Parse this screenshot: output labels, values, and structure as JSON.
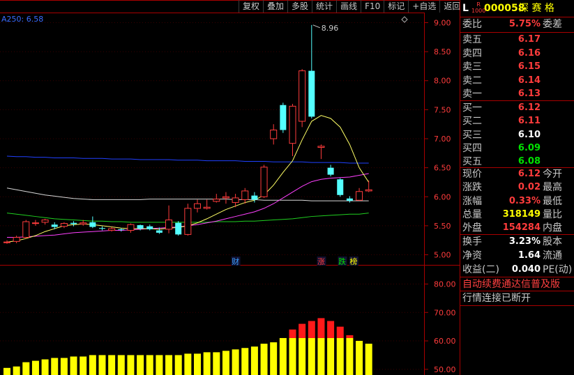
{
  "toolbar": {
    "items": [
      "复权",
      "叠加",
      "多股",
      "统计",
      "画线",
      "F10",
      "标记",
      "+自选",
      "返回"
    ]
  },
  "indicator_label": "A250: 6.58",
  "high_label": "8.96",
  "event_marks": [
    {
      "text": "财",
      "color": "#3aa0ff"
    },
    {
      "text": "涨",
      "color": "#ff3c3c"
    },
    {
      "text": "跌",
      "color": "#00e000"
    },
    {
      "text": "榜",
      "color": "#ffff00"
    }
  ],
  "header": {
    "prefix": "L",
    "badge": "R\n1000",
    "code": "000058",
    "name": "深 赛 格"
  },
  "quote": {
    "weibi": {
      "label": "委比",
      "value": "5.75%",
      "label2": "委差"
    },
    "sells": [
      {
        "label": "卖五",
        "value": "6.17"
      },
      {
        "label": "卖四",
        "value": "6.16"
      },
      {
        "label": "卖三",
        "value": "6.15"
      },
      {
        "label": "卖二",
        "value": "6.14"
      },
      {
        "label": "卖一",
        "value": "6.13"
      }
    ],
    "buys": [
      {
        "label": "买一",
        "value": "6.12",
        "color": "red"
      },
      {
        "label": "买二",
        "value": "6.11",
        "color": "red"
      },
      {
        "label": "买三",
        "value": "6.10",
        "color": "white"
      },
      {
        "label": "买四",
        "value": "6.09",
        "color": "green"
      },
      {
        "label": "买五",
        "value": "6.08",
        "color": "green"
      }
    ],
    "stats": [
      {
        "label": "现价",
        "value": "6.12",
        "color": "red",
        "label2": "今开"
      },
      {
        "label": "涨跌",
        "value": "0.02",
        "color": "red",
        "label2": "最高"
      },
      {
        "label": "涨幅",
        "value": "0.33%",
        "color": "red",
        "label2": "最低"
      },
      {
        "label": "总量",
        "value": "318149",
        "color": "yellow",
        "label2": "量比"
      },
      {
        "label": "外盘",
        "value": "154284",
        "color": "red",
        "label2": "内盘"
      }
    ],
    "stats2": [
      {
        "label": "换手",
        "value": "3.23%",
        "color": "white",
        "label2": "股本"
      },
      {
        "label": "净资",
        "value": "1.64",
        "color": "white",
        "label2": "流通"
      },
      {
        "label": "收益(二)",
        "value": "0.040",
        "color": "white",
        "label2": "PE(动)"
      }
    ]
  },
  "notices": [
    "自动续费通达信普及版",
    "行情连接已断开"
  ],
  "colors": {
    "up": "#ff3c3c",
    "down": "#54ffff",
    "frame": "#aa0000",
    "ma_yellow": "#ffff66",
    "ma_magenta": "#ff40ff",
    "ma_green": "#20d020",
    "ma_blue": "#2040ff",
    "ma_white": "#d8d8d8"
  },
  "chart_data": [
    {
      "type": "candlestick",
      "ylim": [
        4.85,
        9.15
      ],
      "yticks": [
        "9.00",
        "8.50",
        "8.00",
        "7.50",
        "7.00",
        "6.50",
        "6.00",
        "5.50",
        "5.00"
      ],
      "ytick_values": [
        9.0,
        8.5,
        8.0,
        7.5,
        7.0,
        6.5,
        6.0,
        5.5,
        5.0
      ],
      "candles": [
        {
          "o": 5.22,
          "c": 5.22,
          "h": 5.25,
          "l": 5.19
        },
        {
          "o": 5.23,
          "c": 5.3,
          "h": 5.33,
          "l": 5.2
        },
        {
          "o": 5.3,
          "c": 5.57,
          "h": 5.6,
          "l": 5.28
        },
        {
          "o": 5.55,
          "c": 5.55,
          "h": 5.6,
          "l": 5.5
        },
        {
          "o": 5.56,
          "c": 5.6,
          "h": 5.62,
          "l": 5.52
        },
        {
          "o": 5.52,
          "c": 5.48,
          "h": 5.56,
          "l": 5.44
        },
        {
          "o": 5.49,
          "c": 5.54,
          "h": 5.56,
          "l": 5.46
        },
        {
          "o": 5.55,
          "c": 5.53,
          "h": 5.58,
          "l": 5.49
        },
        {
          "o": 5.53,
          "c": 5.55,
          "h": 5.6,
          "l": 5.5
        },
        {
          "o": 5.56,
          "c": 5.48,
          "h": 5.66,
          "l": 5.46
        },
        {
          "o": 5.46,
          "c": 5.45,
          "h": 5.49,
          "l": 5.42
        },
        {
          "o": 5.42,
          "c": 5.45,
          "h": 5.48,
          "l": 5.4
        },
        {
          "o": 5.44,
          "c": 5.43,
          "h": 5.46,
          "l": 5.4
        },
        {
          "o": 5.42,
          "c": 5.52,
          "h": 5.54,
          "l": 5.38
        },
        {
          "o": 5.51,
          "c": 5.45,
          "h": 5.52,
          "l": 5.42
        },
        {
          "o": 5.49,
          "c": 5.44,
          "h": 5.52,
          "l": 5.42
        },
        {
          "o": 5.42,
          "c": 5.38,
          "h": 5.47,
          "l": 5.36
        },
        {
          "o": 5.44,
          "c": 5.6,
          "h": 5.85,
          "l": 5.37
        },
        {
          "o": 5.55,
          "c": 5.35,
          "h": 5.58,
          "l": 5.33
        },
        {
          "o": 5.35,
          "c": 5.8,
          "h": 5.88,
          "l": 5.33
        },
        {
          "o": 5.8,
          "c": 5.88,
          "h": 5.95,
          "l": 5.73
        },
        {
          "o": 5.8,
          "c": 5.82,
          "h": 5.95,
          "l": 5.78
        },
        {
          "o": 5.92,
          "c": 5.96,
          "h": 6.05,
          "l": 5.9
        },
        {
          "o": 5.98,
          "c": 6.0,
          "h": 6.08,
          "l": 5.88
        },
        {
          "o": 5.9,
          "c": 5.98,
          "h": 6.05,
          "l": 5.82
        },
        {
          "o": 5.95,
          "c": 6.1,
          "h": 6.15,
          "l": 5.88
        },
        {
          "o": 6.02,
          "c": 5.95,
          "h": 6.08,
          "l": 5.9
        },
        {
          "o": 6.0,
          "c": 6.51,
          "h": 6.55,
          "l": 5.98
        },
        {
          "o": 7.0,
          "c": 7.15,
          "h": 7.25,
          "l": 6.9
        },
        {
          "o": 7.58,
          "c": 7.15,
          "h": 7.62,
          "l": 7.1
        },
        {
          "o": 6.92,
          "c": 7.56,
          "h": 7.6,
          "l": 6.7
        },
        {
          "o": 7.3,
          "c": 8.17,
          "h": 8.2,
          "l": 7.2
        },
        {
          "o": 8.17,
          "c": 7.38,
          "h": 8.96,
          "l": 7.35
        },
        {
          "o": 6.85,
          "c": 6.87,
          "h": 6.9,
          "l": 6.65
        },
        {
          "o": 6.5,
          "c": 6.38,
          "h": 6.55,
          "l": 6.35
        },
        {
          "o": 6.3,
          "c": 6.03,
          "h": 6.32,
          "l": 6.0
        },
        {
          "o": 5.97,
          "c": 5.93,
          "h": 6.01,
          "l": 5.9
        },
        {
          "o": 5.94,
          "c": 6.09,
          "h": 6.15,
          "l": 5.93
        },
        {
          "o": 6.1,
          "c": 6.12,
          "h": 6.28,
          "l": 6.08
        }
      ],
      "ma_yellow": [
        5.22,
        5.24,
        5.28,
        5.33,
        5.4,
        5.45,
        5.5,
        5.52,
        5.53,
        5.52,
        5.5,
        5.48,
        5.46,
        5.45,
        5.45,
        5.45,
        5.44,
        5.46,
        5.47,
        5.5,
        5.55,
        5.62,
        5.7,
        5.78,
        5.84,
        5.9,
        5.94,
        6.03,
        6.2,
        6.42,
        6.62,
        6.98,
        7.3,
        7.4,
        7.35,
        7.2,
        6.9,
        6.5,
        6.25
      ],
      "ma_magenta": [
        5.3,
        5.3,
        5.31,
        5.32,
        5.33,
        5.34,
        5.36,
        5.38,
        5.39,
        5.4,
        5.41,
        5.42,
        5.42,
        5.43,
        5.44,
        5.45,
        5.46,
        5.47,
        5.48,
        5.5,
        5.52,
        5.55,
        5.58,
        5.62,
        5.66,
        5.7,
        5.74,
        5.8,
        5.88,
        5.98,
        6.08,
        6.18,
        6.26,
        6.3,
        6.32,
        6.33,
        6.34,
        6.37,
        6.4
      ],
      "ma_white": [
        6.15,
        6.12,
        6.09,
        6.06,
        6.03,
        6.01,
        5.99,
        5.97,
        5.96,
        5.95,
        5.95,
        5.95,
        5.95,
        5.95,
        5.95,
        5.96,
        5.96,
        5.96,
        5.96,
        5.96,
        5.96,
        5.96,
        5.96,
        5.96,
        5.95,
        5.95,
        5.95,
        5.94,
        5.94,
        5.94,
        5.94,
        5.94,
        5.93,
        5.93,
        5.93,
        5.93,
        5.93,
        5.93,
        5.93
      ],
      "ma_green": [
        5.72,
        5.7,
        5.68,
        5.66,
        5.64,
        5.62,
        5.61,
        5.6,
        5.59,
        5.58,
        5.58,
        5.57,
        5.57,
        5.56,
        5.56,
        5.56,
        5.56,
        5.56,
        5.56,
        5.56,
        5.56,
        5.56,
        5.57,
        5.57,
        5.57,
        5.58,
        5.58,
        5.59,
        5.6,
        5.61,
        5.62,
        5.64,
        5.66,
        5.67,
        5.68,
        5.69,
        5.7,
        5.7,
        5.72
      ],
      "ma_blue": [
        6.7,
        6.69,
        6.69,
        6.68,
        6.68,
        6.67,
        6.67,
        6.67,
        6.66,
        6.66,
        6.66,
        6.65,
        6.65,
        6.65,
        6.64,
        6.64,
        6.64,
        6.64,
        6.63,
        6.63,
        6.63,
        6.62,
        6.62,
        6.62,
        6.62,
        6.61,
        6.61,
        6.61,
        6.6,
        6.6,
        6.6,
        6.6,
        6.59,
        6.59,
        6.59,
        6.59,
        6.58,
        6.58,
        6.58
      ]
    },
    {
      "type": "bar",
      "ylim": [
        48,
        86
      ],
      "yticks": [
        "80.00",
        "70.00",
        "60.00",
        "50.00"
      ],
      "ytick_values": [
        80,
        70,
        60,
        50
      ],
      "threshold": 61,
      "values": [
        50.5,
        51,
        52.5,
        53,
        53.5,
        54,
        54,
        54.5,
        54.5,
        55,
        55,
        55,
        55,
        55,
        55,
        55,
        55,
        55,
        55,
        55.5,
        55.5,
        56,
        56,
        56.5,
        57,
        57.5,
        58,
        59,
        59.5,
        61,
        64,
        66,
        67,
        68,
        67,
        65,
        62,
        60,
        59
      ]
    }
  ]
}
